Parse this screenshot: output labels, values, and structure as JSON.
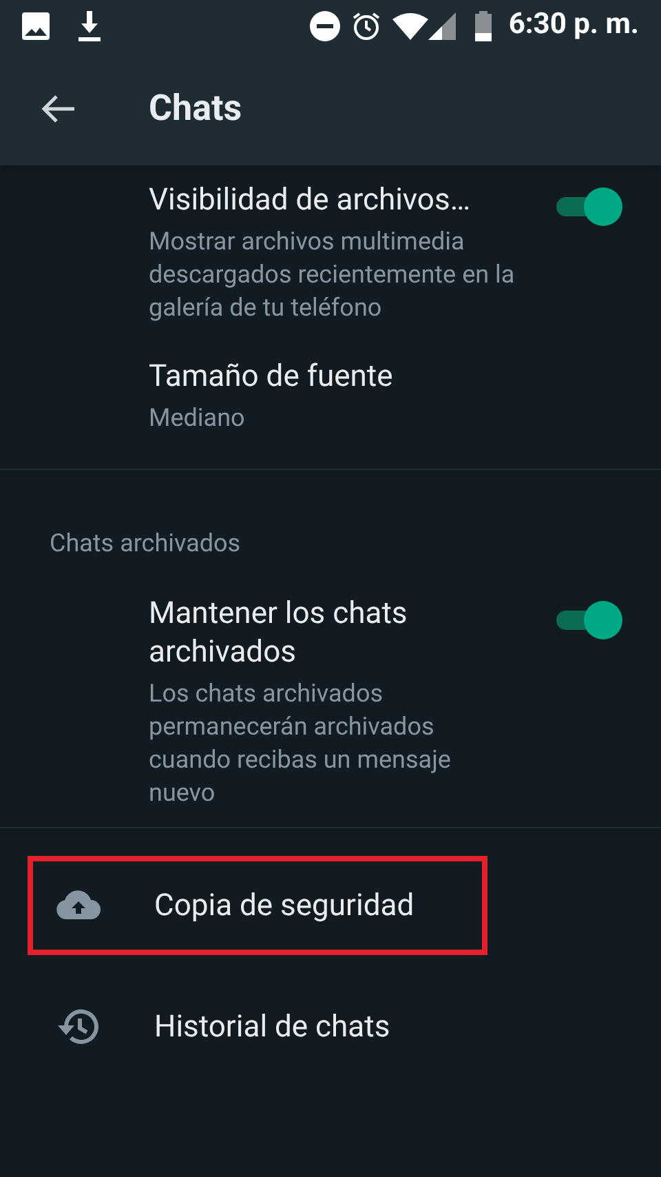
{
  "status_bar": {
    "time": "6:30 p. m."
  },
  "header": {
    "title": "Chats"
  },
  "sections": [
    {
      "items": [
        {
          "kind": "toggle",
          "title": "Visibilidad de archivos…",
          "subtitle": "Mostrar archivos multimedia descargados recientemente en la galería de tu teléfono",
          "on": true
        },
        {
          "kind": "text",
          "title": "Tamaño de fuente",
          "subtitle": "Mediano"
        }
      ]
    },
    {
      "heading": "Chats archivados",
      "items": [
        {
          "kind": "toggle",
          "title": "Mantener los chats archivados",
          "subtitle": "Los chats archivados permanecerán archivados cuando recibas un mensaje nuevo",
          "on": true
        }
      ]
    },
    {
      "items": [
        {
          "kind": "backup",
          "title": "Copia de seguridad",
          "highlighted": true
        },
        {
          "kind": "history",
          "title": "Historial de chats",
          "highlighted": false
        }
      ]
    }
  ]
}
